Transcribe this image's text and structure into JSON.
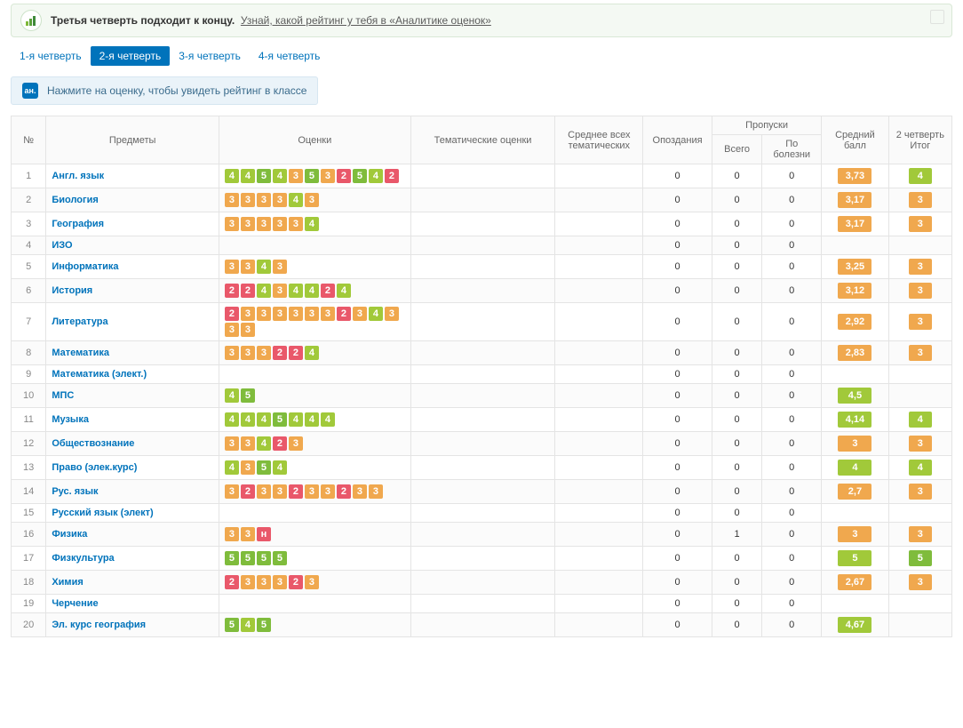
{
  "banner": {
    "title": "Третья четверть подходит к концу.",
    "link": "Узнай, какой рейтинг у тебя в «Аналитике оценок»"
  },
  "tabs": [
    "1-я четверть",
    "2-я четверть",
    "3-я четверть",
    "4-я четверть"
  ],
  "activeTab": 1,
  "hint": {
    "icon": "aн.",
    "text": "Нажмите на оценку, чтобы увидеть рейтинг в классе"
  },
  "columns": {
    "num": "№",
    "subjects": "Предметы",
    "marks": "Оценки",
    "thematic": "Тематические оценки",
    "avgThematic": "Среднее всех тематических",
    "late": "Опоздания",
    "absences": "Пропуски",
    "absTotal": "Всего",
    "absIll": "По болезни",
    "avg": "Средний балл",
    "final": "2 четверть Итог"
  },
  "gradeColor": {
    "2": "m2",
    "3": "m3",
    "4": "m4",
    "5": "m5",
    "н": "mh"
  },
  "avgColor": "avg-orange",
  "rows": [
    {
      "n": 1,
      "subject": "Англ. язык",
      "marks": [
        "4",
        "4",
        "5",
        "4",
        "3",
        "5",
        "3",
        "2",
        "5",
        "4",
        "2"
      ],
      "late": 0,
      "abs": 0,
      "ill": 0,
      "avg": "3,73",
      "avgColor": "avg-orange",
      "final": "4",
      "finalColor": "m4"
    },
    {
      "n": 2,
      "subject": "Биология",
      "marks": [
        "3",
        "3",
        "3",
        "3",
        "4",
        "3"
      ],
      "late": 0,
      "abs": 0,
      "ill": 0,
      "avg": "3,17",
      "avgColor": "avg-orange",
      "final": "3",
      "finalColor": "m3"
    },
    {
      "n": 3,
      "subject": "География",
      "marks": [
        "3",
        "3",
        "3",
        "3",
        "3",
        "4"
      ],
      "late": 0,
      "abs": 0,
      "ill": 0,
      "avg": "3,17",
      "avgColor": "avg-orange",
      "final": "3",
      "finalColor": "m3"
    },
    {
      "n": 4,
      "subject": "ИЗО",
      "marks": [],
      "late": 0,
      "abs": 0,
      "ill": 0,
      "avg": "",
      "avgColor": "",
      "final": "",
      "finalColor": ""
    },
    {
      "n": 5,
      "subject": "Информатика",
      "marks": [
        "3",
        "3",
        "4",
        "3"
      ],
      "late": 0,
      "abs": 0,
      "ill": 0,
      "avg": "3,25",
      "avgColor": "avg-orange",
      "final": "3",
      "finalColor": "m3"
    },
    {
      "n": 6,
      "subject": "История",
      "marks": [
        "2",
        "2",
        "4",
        "3",
        "4",
        "4",
        "2",
        "4"
      ],
      "late": 0,
      "abs": 0,
      "ill": 0,
      "avg": "3,12",
      "avgColor": "avg-orange",
      "final": "3",
      "finalColor": "m3"
    },
    {
      "n": 7,
      "subject": "Литература",
      "marks": [
        "2",
        "3",
        "3",
        "3",
        "3",
        "3",
        "3",
        "2",
        "3",
        "4",
        "3",
        "3",
        "3"
      ],
      "late": 0,
      "abs": 0,
      "ill": 0,
      "avg": "2,92",
      "avgColor": "avg-orange",
      "final": "3",
      "finalColor": "m3"
    },
    {
      "n": 8,
      "subject": "Математика",
      "marks": [
        "3",
        "3",
        "3",
        "2",
        "2",
        "4"
      ],
      "late": 0,
      "abs": 0,
      "ill": 0,
      "avg": "2,83",
      "avgColor": "avg-orange",
      "final": "3",
      "finalColor": "m3"
    },
    {
      "n": 9,
      "subject": "Математика (элект.)",
      "marks": [],
      "late": 0,
      "abs": 0,
      "ill": 0,
      "avg": "",
      "avgColor": "",
      "final": "",
      "finalColor": ""
    },
    {
      "n": 10,
      "subject": "МПС",
      "marks": [
        "4",
        "5"
      ],
      "late": 0,
      "abs": 0,
      "ill": 0,
      "avg": "4,5",
      "avgColor": "avg-green",
      "final": "",
      "finalColor": ""
    },
    {
      "n": 11,
      "subject": "Музыка",
      "marks": [
        "4",
        "4",
        "4",
        "5",
        "4",
        "4",
        "4"
      ],
      "late": 0,
      "abs": 0,
      "ill": 0,
      "avg": "4,14",
      "avgColor": "avg-green",
      "final": "4",
      "finalColor": "m4"
    },
    {
      "n": 12,
      "subject": "Обществознание",
      "marks": [
        "3",
        "3",
        "4",
        "2",
        "3"
      ],
      "late": 0,
      "abs": 0,
      "ill": 0,
      "avg": "3",
      "avgColor": "avg-orange",
      "final": "3",
      "finalColor": "m3"
    },
    {
      "n": 13,
      "subject": "Право (элек.курс)",
      "marks": [
        "4",
        "3",
        "5",
        "4"
      ],
      "late": 0,
      "abs": 0,
      "ill": 0,
      "avg": "4",
      "avgColor": "avg-green",
      "final": "4",
      "finalColor": "m4"
    },
    {
      "n": 14,
      "subject": "Рус. язык",
      "marks": [
        "3",
        "2",
        "3",
        "3",
        "2",
        "3",
        "3",
        "2",
        "3",
        "3"
      ],
      "late": 0,
      "abs": 0,
      "ill": 0,
      "avg": "2,7",
      "avgColor": "avg-orange",
      "final": "3",
      "finalColor": "m3"
    },
    {
      "n": 15,
      "subject": "Русский язык (элект)",
      "marks": [],
      "late": 0,
      "abs": 0,
      "ill": 0,
      "avg": "",
      "avgColor": "",
      "final": "",
      "finalColor": ""
    },
    {
      "n": 16,
      "subject": "Физика",
      "marks": [
        "3",
        "3",
        "н"
      ],
      "late": 0,
      "abs": 1,
      "ill": 0,
      "avg": "3",
      "avgColor": "avg-orange",
      "final": "3",
      "finalColor": "m3"
    },
    {
      "n": 17,
      "subject": "Физкультура",
      "marks": [
        "5",
        "5",
        "5",
        "5"
      ],
      "late": 0,
      "abs": 0,
      "ill": 0,
      "avg": "5",
      "avgColor": "avg-green",
      "final": "5",
      "finalColor": "m5"
    },
    {
      "n": 18,
      "subject": "Химия",
      "marks": [
        "2",
        "3",
        "3",
        "3",
        "2",
        "3"
      ],
      "late": 0,
      "abs": 0,
      "ill": 0,
      "avg": "2,67",
      "avgColor": "avg-orange",
      "final": "3",
      "finalColor": "m3"
    },
    {
      "n": 19,
      "subject": "Черчение",
      "marks": [],
      "late": 0,
      "abs": 0,
      "ill": 0,
      "avg": "",
      "avgColor": "",
      "final": "",
      "finalColor": ""
    },
    {
      "n": 20,
      "subject": "Эл. курс география",
      "marks": [
        "5",
        "4",
        "5"
      ],
      "late": 0,
      "abs": 0,
      "ill": 0,
      "avg": "4,67",
      "avgColor": "avg-green",
      "final": "",
      "finalColor": ""
    }
  ]
}
